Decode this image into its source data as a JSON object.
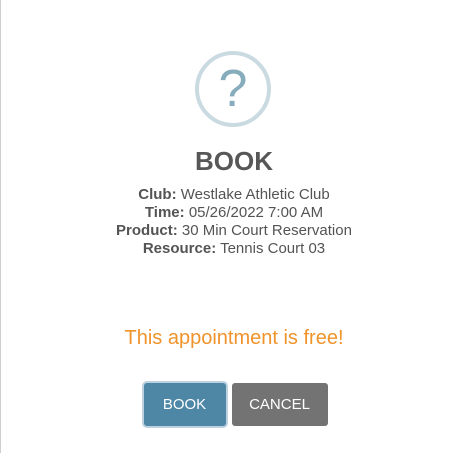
{
  "dialog": {
    "icon": "question-mark-icon",
    "icon_glyph": "?",
    "title": "BOOK",
    "details": [
      {
        "label": "Club:",
        "value": "Westlake Athletic Club"
      },
      {
        "label": "Time:",
        "value": "05/26/2022 7:00 AM"
      },
      {
        "label": "Product:",
        "value": "30 Min Court Reservation"
      },
      {
        "label": "Resource:",
        "value": "Tennis Court 03"
      }
    ],
    "free_note": "This appointment is free!",
    "book_label": "BOOK",
    "cancel_label": "CANCEL"
  },
  "colors": {
    "accent": "#4e86a6",
    "cancel": "#737373",
    "note": "#f0932b",
    "icon": "#87adbd"
  }
}
